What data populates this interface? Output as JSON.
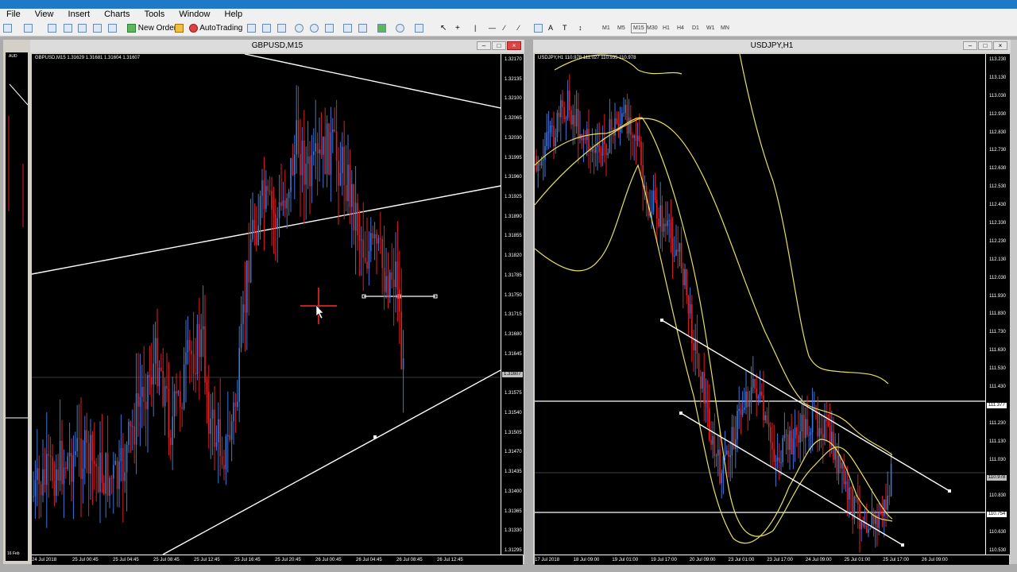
{
  "menu": [
    "File",
    "View",
    "Insert",
    "Charts",
    "Tools",
    "Window",
    "Help"
  ],
  "toolbar": {
    "new_order": "New Order",
    "autotrading": "AutoTrading",
    "timeframes": [
      "M1",
      "M5",
      "M15",
      "M30",
      "H1",
      "H4",
      "D1",
      "W1",
      "MN"
    ]
  },
  "left_window": {
    "title": "GBPUSD,M15",
    "info": "GBPUSD,M15  1.31629 1.31681 1.31604 1.31607",
    "y_labels": [
      "1.32170",
      "1.32135",
      "1.32100",
      "1.32065",
      "1.32030",
      "1.31995",
      "1.31960",
      "1.31925",
      "1.31890",
      "1.31855",
      "1.31820",
      "1.31785",
      "1.31750",
      "1.31715",
      "1.31680",
      "1.31645",
      "1.31607",
      "1.31575",
      "1.31540",
      "1.31505",
      "1.31470",
      "1.31435",
      "1.31400",
      "1.31365",
      "1.31330",
      "1.31295"
    ],
    "current_price": "1.31607",
    "x_labels": [
      "24 Jul 2018",
      "25 Jul 00:45",
      "25 Jul 04:45",
      "25 Jul 08:45",
      "25 Jul 12:45",
      "25 Jul 16:45",
      "25 Jul 20:45",
      "26 Jul 00:45",
      "26 Jul 04:45",
      "26 Jul 08:45",
      "26 Jul 12:45"
    ]
  },
  "back_window": {
    "info": "AUD",
    "date": "16 Feb"
  },
  "right_window": {
    "title": "USDJPY,H1",
    "info": "USDJPY,H1  110.978 111.027 110.935 110.978",
    "y_labels": [
      "113.230",
      "113.130",
      "113.030",
      "112.930",
      "112.830",
      "112.730",
      "112.630",
      "112.530",
      "112.430",
      "112.330",
      "112.230",
      "112.130",
      "112.030",
      "111.930",
      "111.830",
      "111.730",
      "111.630",
      "111.530",
      "111.430",
      "111.377",
      "111.230",
      "111.130",
      "111.030",
      "110.978",
      "110.830",
      "110.754",
      "110.630",
      "110.530"
    ],
    "level_1": "111.377",
    "current_price": "110.978",
    "level_2": "110.754",
    "x_labels": [
      "17 Jul 2018",
      "18 Jul 09:00",
      "19 Jul 01:00",
      "19 Jul 17:00",
      "20 Jul 09:00",
      "23 Jul 01:00",
      "23 Jul 17:00",
      "24 Jul 09:00",
      "25 Jul 01:00",
      "25 Jul 17:00",
      "26 Jul 09:00"
    ]
  },
  "colors": {
    "bull": "#3c78d8",
    "bear": "#e02020",
    "trendline": "#ffffff",
    "band": "#e8e060"
  }
}
